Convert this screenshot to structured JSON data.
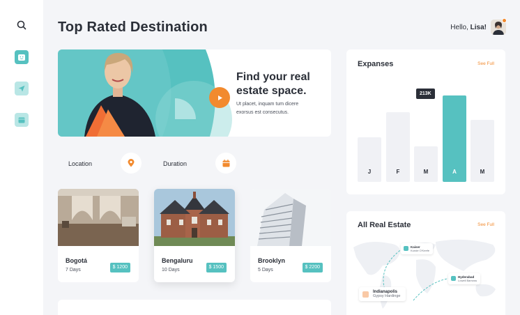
{
  "page": {
    "title": "Top Rated Destination"
  },
  "header": {
    "greeting": "Hello,",
    "user_name": "Lisa!"
  },
  "sidebar": {
    "icons": [
      "search-icon",
      "smile-icon",
      "send-icon",
      "calendar-icon"
    ]
  },
  "hero": {
    "title": "Find your real estate space.",
    "subtitle": "Ut placet, inquam tum dicere exorsus est consecutus."
  },
  "filters": {
    "location_label": "Location",
    "duration_label": "Duration"
  },
  "destinations": [
    {
      "name": "Bogotá",
      "days": "7 Days",
      "price": "$ 1200"
    },
    {
      "name": "Bengaluru",
      "days": "10 Days",
      "price": "$ 1500"
    },
    {
      "name": "Brooklyn",
      "days": "5 Days",
      "price": "$ 2200"
    }
  ],
  "expanses": {
    "title": "Expanses",
    "see_full": "See Full",
    "tooltip": "213K"
  },
  "chart_data": {
    "type": "bar",
    "categories": [
      "J",
      "F",
      "M",
      "A",
      "M"
    ],
    "values": [
      0.52,
      0.81,
      0.41,
      1.0,
      0.72
    ],
    "highlight_index": 3,
    "colors": {
      "highlight": "#56c1c0",
      "normal": "#f0f1f5"
    }
  },
  "real_estate": {
    "title": "All Real Estate",
    "see_full": "See Full",
    "pins": [
      {
        "name": "Kaiser",
        "sub": "Kunde O'Keefe"
      },
      {
        "name": "Hyderabad",
        "sub": "Lowell Barrows"
      },
      {
        "name": "Indianapolis",
        "sub": "Gypsy Hardinge"
      }
    ]
  },
  "colors": {
    "accent": "#56c1c0",
    "orange": "#f28a2e",
    "dark": "#2b2f38"
  }
}
